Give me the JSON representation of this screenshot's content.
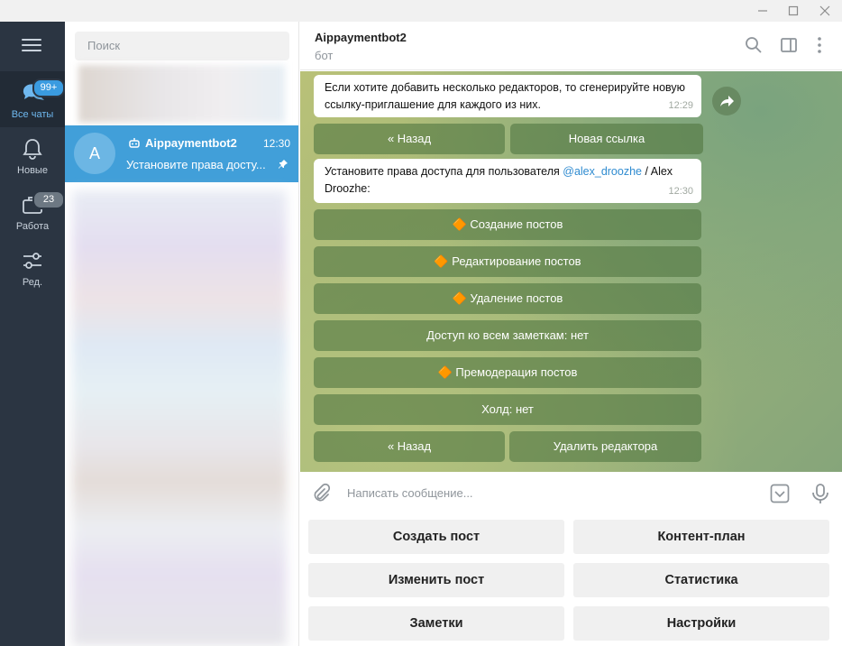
{
  "sidebar": {
    "menu_icon": "hamburger-icon",
    "folders": [
      {
        "label": "Все чаты",
        "badge": "99+",
        "icon": "chats-icon",
        "active": true
      },
      {
        "label": "Новые",
        "badge": "",
        "icon": "bell-icon",
        "active": false
      },
      {
        "label": "Работа",
        "badge": "23",
        "icon": "briefcase-icon",
        "active": false
      },
      {
        "label": "Ред.",
        "badge": "",
        "icon": "sliders-icon",
        "active": false
      }
    ]
  },
  "chat_list": {
    "search_placeholder": "Поиск",
    "active_chat": {
      "avatar_letter": "A",
      "name": "Aippaymentbot2",
      "time": "12:30",
      "preview": "Установите права досту..."
    }
  },
  "chat": {
    "title": "Aippaymentbot2",
    "subtitle": "бот",
    "messages": [
      {
        "text": "Если хотите добавить несколько редакторов, то сгенерируйте новую ссылку-приглашение для каждого из них.",
        "time": "12:29"
      },
      {
        "text_before": "Установите права доступа для пользователя ",
        "mention": "@alex_droozhe",
        "text_after": " / Alex Droozhe:",
        "time": "12:30"
      }
    ],
    "inline_row1": [
      "« Назад",
      "Новая ссылка"
    ],
    "inline_buttons": [
      "🔶 Создание постов",
      "🔶 Редактирование постов",
      "🔶 Удаление постов",
      "Доступ ко всем заметкам: нет",
      "🔶 Премодерация постов",
      "Холд: нет"
    ],
    "inline_last_row": [
      "« Назад",
      "Удалить редактора"
    ],
    "input_placeholder": "Написать сообщение..."
  },
  "reply_keyboard": [
    [
      "Создать пост",
      "Контент-план"
    ],
    [
      "Изменить пост",
      "Статистика"
    ],
    [
      "Заметки",
      "Настройки"
    ]
  ],
  "colors": {
    "rail_bg": "#2b3542",
    "active_chat_bg": "#419fd9",
    "accent": "#3a9be0",
    "link": "#2f8bd0"
  }
}
